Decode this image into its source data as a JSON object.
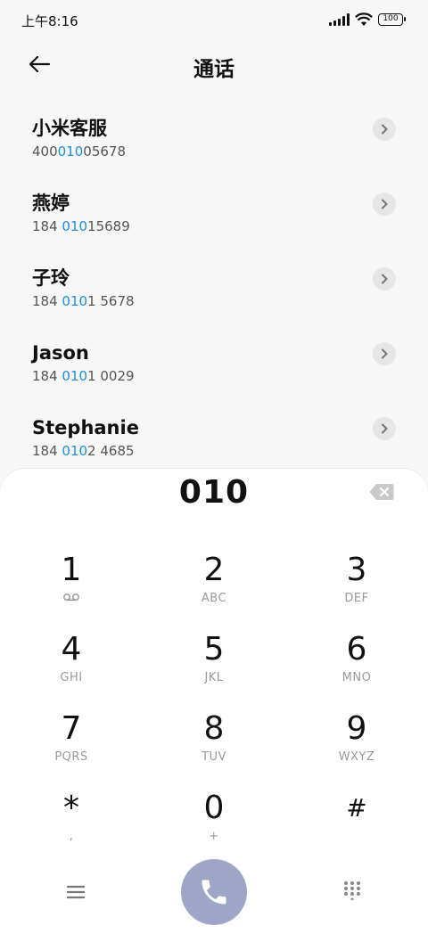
{
  "status_bar": {
    "time": "上午8:16",
    "battery": "100"
  },
  "header": {
    "title": "通话",
    "back_icon": "arrow-left-icon"
  },
  "contacts": [
    {
      "name": "小米客服",
      "number_pre": "400",
      "number_match": "010",
      "number_post": "05678"
    },
    {
      "name": "燕婷",
      "number_pre": "184 ",
      "number_match": "010",
      "number_post": "15689"
    },
    {
      "name": "子玲",
      "number_pre": "184 ",
      "number_match": "010",
      "number_post": "1 5678"
    },
    {
      "name": "Jason",
      "number_pre": "184 ",
      "number_match": "010",
      "number_post": "1 0029"
    },
    {
      "name": "Stephanie",
      "number_pre": "184 ",
      "number_match": "010",
      "number_post": "2 4685"
    }
  ],
  "dialer": {
    "input": "010",
    "keys": [
      {
        "digit": "1",
        "letters": ""
      },
      {
        "digit": "2",
        "letters": "ABC"
      },
      {
        "digit": "3",
        "letters": "DEF"
      },
      {
        "digit": "4",
        "letters": "GHI"
      },
      {
        "digit": "5",
        "letters": "JKL"
      },
      {
        "digit": "6",
        "letters": "MNO"
      },
      {
        "digit": "7",
        "letters": "PQRS"
      },
      {
        "digit": "8",
        "letters": "TUV"
      },
      {
        "digit": "9",
        "letters": "WXYZ"
      },
      {
        "digit": "*",
        "letters": ","
      },
      {
        "digit": "0",
        "letters": "+"
      },
      {
        "digit": "#",
        "letters": ""
      }
    ]
  },
  "colors": {
    "highlight": "#1a8fe0",
    "call_button": "#9ea5c6"
  }
}
